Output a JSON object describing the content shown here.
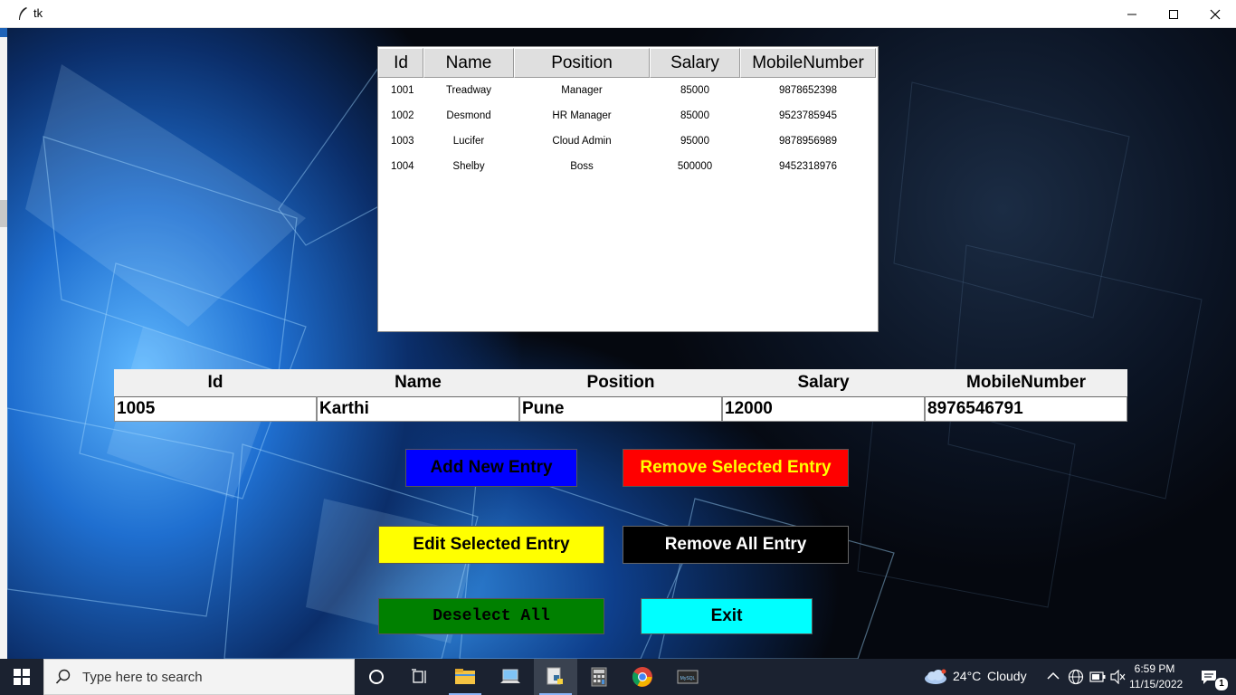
{
  "window": {
    "title": "tk"
  },
  "tree": {
    "columns": [
      "Id",
      "Name",
      "Position",
      "Salary",
      "MobileNumber"
    ],
    "rows": [
      [
        "1001",
        "Treadway",
        "Manager",
        "85000",
        "9878652398"
      ],
      [
        "1002",
        "Desmond",
        "HR Manager",
        "85000",
        "9523785945"
      ],
      [
        "1003",
        "Lucifer",
        "Cloud Admin",
        "95000",
        "9878956989"
      ],
      [
        "1004",
        "Shelby",
        "Boss",
        "500000",
        "9452318976"
      ]
    ]
  },
  "form": {
    "labels": {
      "id": "Id",
      "name": "Name",
      "position": "Position",
      "salary": "Salary",
      "mobile": "MobileNumber"
    },
    "values": {
      "id": "1005",
      "name": "Karthi",
      "position": "Pune",
      "salary": "12000",
      "mobile": "8976546791"
    }
  },
  "buttons": {
    "add": "Add New Entry",
    "remove_selected": "Remove Selected Entry",
    "edit": "Edit Selected Entry",
    "remove_all": "Remove All Entry",
    "deselect": "Deselect All",
    "exit": "Exit"
  },
  "button_colors": {
    "add": "#0000ff",
    "remove_selected": "#ff0000",
    "edit": "#ffff00",
    "remove_all": "#000000",
    "deselect": "#008000",
    "exit": "#00ffff"
  },
  "taskbar": {
    "search_placeholder": "Type here to search",
    "weather_temp": "24°C",
    "weather_text": "Cloudy",
    "time": "6:59 PM",
    "date": "11/15/2022",
    "notification_count": "1",
    "icons": [
      "windows-start-icon",
      "search-icon",
      "cortana-icon",
      "task-view-icon",
      "file-explorer-icon",
      "computer-icon",
      "python-idle-icon",
      "calculator-icon",
      "chrome-icon",
      "mysql-icon"
    ]
  }
}
